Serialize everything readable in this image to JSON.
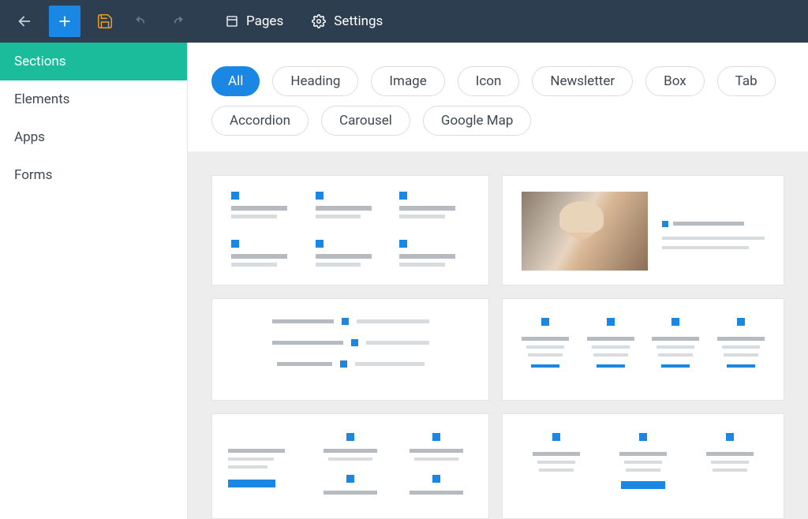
{
  "topbar": {
    "pages_label": "Pages",
    "settings_label": "Settings"
  },
  "sidebar": {
    "items": [
      {
        "label": "Sections",
        "active": true
      },
      {
        "label": "Elements",
        "active": false
      },
      {
        "label": "Apps",
        "active": false
      },
      {
        "label": "Forms",
        "active": false
      }
    ]
  },
  "filters": [
    {
      "label": "All",
      "active": true
    },
    {
      "label": "Heading",
      "active": false
    },
    {
      "label": "Image",
      "active": false
    },
    {
      "label": "Icon",
      "active": false
    },
    {
      "label": "Newsletter",
      "active": false
    },
    {
      "label": "Box",
      "active": false
    },
    {
      "label": "Tab",
      "active": false
    },
    {
      "label": "Accordion",
      "active": false
    },
    {
      "label": "Carousel",
      "active": false
    },
    {
      "label": "Google Map",
      "active": false
    }
  ]
}
